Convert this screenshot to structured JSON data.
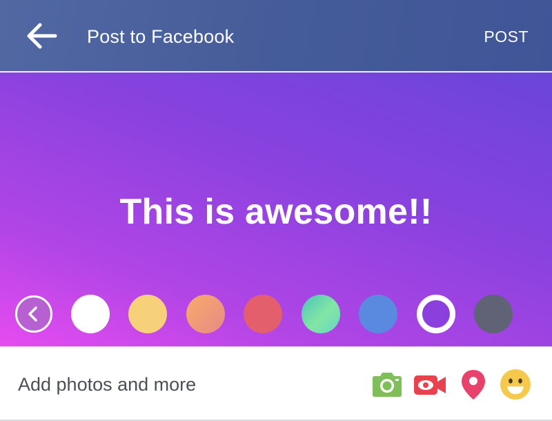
{
  "header": {
    "title": "Post to Facebook",
    "post_label": "POST",
    "back_icon": "arrow-left-icon"
  },
  "composer": {
    "text": "This is awesome!!",
    "background_colors": [
      "#6a45d9",
      "#8a42df",
      "#b245e6",
      "#e64cf0"
    ]
  },
  "swatches": {
    "collapse_icon": "chevron-left-icon",
    "items": [
      {
        "name": "white",
        "color": "#ffffff"
      },
      {
        "name": "yellow",
        "color": "#f7d07a"
      },
      {
        "name": "peach-gradient",
        "color": "#f7ab6a"
      },
      {
        "name": "red",
        "color": "#e35f6c"
      },
      {
        "name": "teal-gradient",
        "color": "#4cc2ba"
      },
      {
        "name": "blue",
        "color": "#5a8ae0"
      },
      {
        "name": "purple-gradient",
        "color": "#8b3fdc",
        "selected": true
      },
      {
        "name": "dark-gray",
        "color": "#5f6375"
      }
    ]
  },
  "bottom_bar": {
    "add_label": "Add photos and more",
    "icons": [
      "camera-icon",
      "video-icon",
      "location-pin-icon",
      "smiley-icon"
    ],
    "icon_colors": {
      "camera": "#7fbf5a",
      "video": "#e8424f",
      "location": "#e8416c",
      "feeling": "#f4c94c"
    }
  },
  "theme": {
    "header_color": "#465d9a"
  }
}
